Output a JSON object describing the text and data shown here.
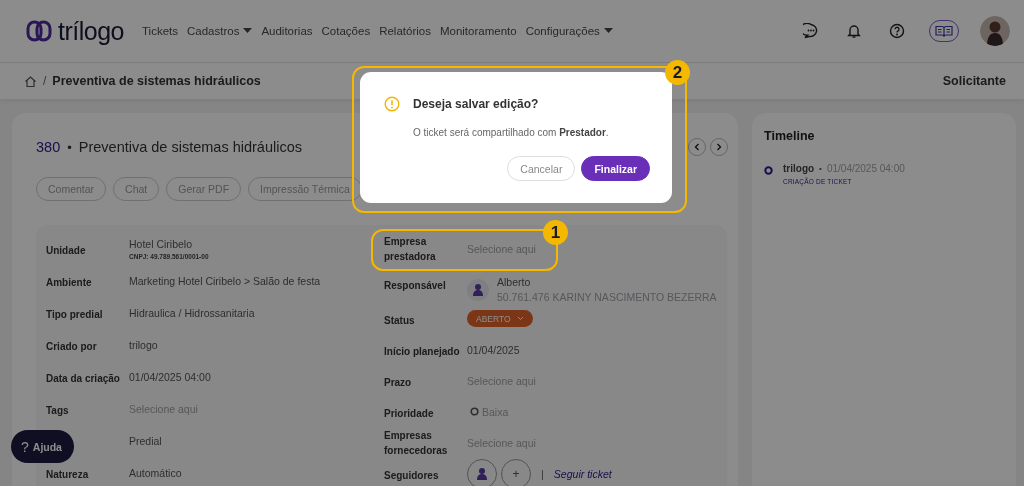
{
  "header": {
    "logo": "trílogo",
    "nav": [
      {
        "label": "Tickets",
        "dropdown": false
      },
      {
        "label": "Cadastros",
        "dropdown": true
      },
      {
        "label": "Auditorias",
        "dropdown": false
      },
      {
        "label": "Cotações",
        "dropdown": false
      },
      {
        "label": "Relatórios",
        "dropdown": false
      },
      {
        "label": "Monitoramento",
        "dropdown": false
      },
      {
        "label": "Configurações",
        "dropdown": true
      }
    ]
  },
  "breadcrumb": {
    "separator": "/",
    "current": "Preventiva de sistemas hidráulicos",
    "role": "Solicitante"
  },
  "ticket": {
    "number": "380",
    "separator": "•",
    "title": "Preventiva de sistemas hidráulicos",
    "actions": [
      "Comentar",
      "Chat",
      "Gerar PDF",
      "Impressão Térmica"
    ],
    "left_fields": [
      {
        "label": "Unidade",
        "value": "Hotel Ciribelo",
        "note": "CNPJ: 49.789.561/0001-00"
      },
      {
        "label": "Ambiente",
        "value": "Marketing Hotel Ciribelo > Salão de festa"
      },
      {
        "label": "Tipo predial",
        "value": "Hidraulica / Hidrossanitaria"
      },
      {
        "label": "Criado por",
        "value": "trilogo"
      },
      {
        "label": "Data da criação",
        "value": "01/04/2025 04:00"
      },
      {
        "label": "Tags",
        "placeholder": "Selecione aqui"
      },
      {
        "value": "Predial"
      },
      {
        "label": "Natureza",
        "value": "Automático"
      }
    ],
    "right_fields": [
      {
        "kind": "text",
        "label": "Empresa prestadora",
        "placeholder": "Selecione aqui"
      },
      {
        "kind": "person",
        "label": "Responsável",
        "name": "Alberto",
        "detail": "50.761.476 KARINY NASCIMENTO BEZERRA"
      },
      {
        "kind": "status",
        "label": "Status",
        "value": "ABERTO"
      },
      {
        "kind": "text",
        "label": "Início planejado",
        "value": "01/04/2025"
      },
      {
        "kind": "text",
        "label": "Prazo",
        "placeholder": "Selecione aqui"
      },
      {
        "kind": "priority",
        "label": "Prioridade",
        "value": "Baixa"
      },
      {
        "kind": "text",
        "label": "Empresas fornecedoras",
        "placeholder": "Selecione aqui"
      },
      {
        "kind": "followers",
        "label": "Seguidores",
        "add": "+",
        "separator": "|",
        "link": "Seguir ticket"
      }
    ]
  },
  "timeline": {
    "title": "Timeline",
    "entries": [
      {
        "author": "trilogo",
        "separator": "•",
        "time": "01/04/2025 04:00",
        "event": "CRIAÇÃO DE TICKET"
      }
    ]
  },
  "help_button": {
    "label": "Ajuda",
    "icon": "?"
  },
  "dialog": {
    "title": "Deseja salvar edição?",
    "message": "O ticket será compartilhado com **Prestador**.",
    "buttons": [
      {
        "label": "Cancelar",
        "primary": false
      },
      {
        "label": "Finalizar",
        "primary": true
      }
    ]
  },
  "callouts": [
    {
      "number": "1"
    },
    {
      "number": "2"
    }
  ]
}
